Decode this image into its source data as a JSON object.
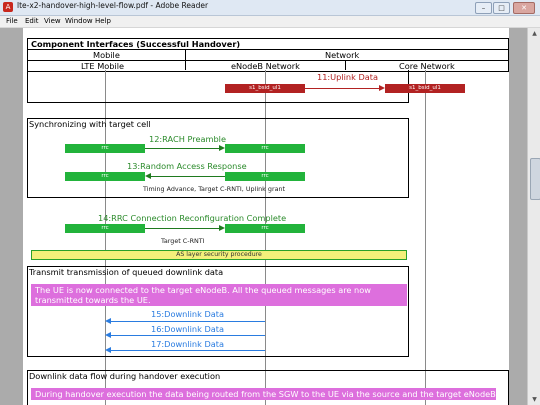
{
  "window": {
    "title": "lte-x2-handover-high-level-flow.pdf - Adobe Reader",
    "icon": "pdf-icon"
  },
  "menu": [
    "File",
    "Edit",
    "View",
    "Window",
    "Help"
  ],
  "header": {
    "title": "Component Interfaces (Successful Handover)",
    "mobile": "Mobile",
    "network": "Network",
    "lte_mobile": "LTE Mobile",
    "enodeb": "eNodeB Network",
    "core": "Core Network"
  },
  "messages": {
    "m11": {
      "label": "11:Uplink Data",
      "from_bar": "s1_bsid_ul1",
      "to_bar": "s1_bsid_ul1"
    },
    "m12": {
      "label": "12:RACH Preamble",
      "from_bar": "rrc",
      "to_bar": "rrc"
    },
    "m13": {
      "label": "13:Random Access Response",
      "from_bar": "rrc",
      "to_bar": "rrc",
      "note": "Timing Advance, Target C-RNTI, Uplink grant"
    },
    "m14": {
      "label": "14:RRC Connection Reconfiguration Complete",
      "from_bar": "rrc",
      "to_bar": "rrc",
      "note": "Target C-RNTI"
    },
    "m15": {
      "label": "15:Downlink Data"
    },
    "m16": {
      "label": "16:Downlink Data"
    },
    "m17": {
      "label": "17:Downlink Data"
    }
  },
  "sections": {
    "sync": "Synchronizing with target cell",
    "as_security": "AS layer security procedure",
    "transmit": "Transmit transmission of queued downlink data",
    "transmit_note": "The UE is now connected to the target eNodeB. All the queued messages are now transmitted towards the UE.",
    "downlink_flow": "Downlink data flow during handover execution",
    "downlink_note": "During handover execution the data being routed from the SGW to  the UE via the source and the target eNodeBs."
  },
  "colors": {
    "red_bar": "#b22222",
    "green_bar": "#22b33b",
    "green_text": "#2a8a2a",
    "blue": "#2a7ce0",
    "pink": "#dd6fdd",
    "yellow": "#f3f07a"
  }
}
